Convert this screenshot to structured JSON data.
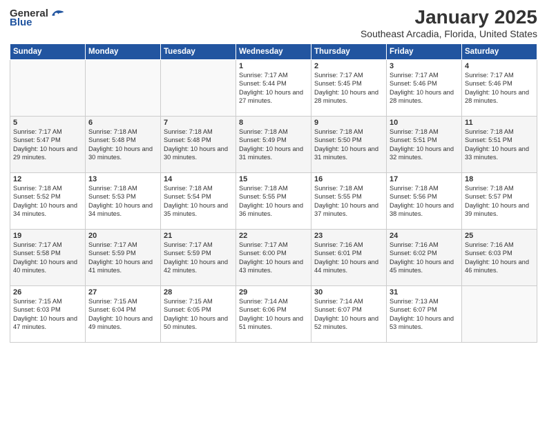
{
  "app": {
    "logo_general": "General",
    "logo_blue": "Blue",
    "title": "January 2025",
    "subtitle": "Southeast Arcadia, Florida, United States"
  },
  "calendar": {
    "headers": [
      "Sunday",
      "Monday",
      "Tuesday",
      "Wednesday",
      "Thursday",
      "Friday",
      "Saturday"
    ],
    "weeks": [
      [
        {
          "day": "",
          "content": ""
        },
        {
          "day": "",
          "content": ""
        },
        {
          "day": "",
          "content": ""
        },
        {
          "day": "1",
          "content": "Sunrise: 7:17 AM\nSunset: 5:44 PM\nDaylight: 10 hours\nand 27 minutes."
        },
        {
          "day": "2",
          "content": "Sunrise: 7:17 AM\nSunset: 5:45 PM\nDaylight: 10 hours\nand 28 minutes."
        },
        {
          "day": "3",
          "content": "Sunrise: 7:17 AM\nSunset: 5:46 PM\nDaylight: 10 hours\nand 28 minutes."
        },
        {
          "day": "4",
          "content": "Sunrise: 7:17 AM\nSunset: 5:46 PM\nDaylight: 10 hours\nand 28 minutes."
        }
      ],
      [
        {
          "day": "5",
          "content": "Sunrise: 7:17 AM\nSunset: 5:47 PM\nDaylight: 10 hours\nand 29 minutes."
        },
        {
          "day": "6",
          "content": "Sunrise: 7:18 AM\nSunset: 5:48 PM\nDaylight: 10 hours\nand 30 minutes."
        },
        {
          "day": "7",
          "content": "Sunrise: 7:18 AM\nSunset: 5:48 PM\nDaylight: 10 hours\nand 30 minutes."
        },
        {
          "day": "8",
          "content": "Sunrise: 7:18 AM\nSunset: 5:49 PM\nDaylight: 10 hours\nand 31 minutes."
        },
        {
          "day": "9",
          "content": "Sunrise: 7:18 AM\nSunset: 5:50 PM\nDaylight: 10 hours\nand 31 minutes."
        },
        {
          "day": "10",
          "content": "Sunrise: 7:18 AM\nSunset: 5:51 PM\nDaylight: 10 hours\nand 32 minutes."
        },
        {
          "day": "11",
          "content": "Sunrise: 7:18 AM\nSunset: 5:51 PM\nDaylight: 10 hours\nand 33 minutes."
        }
      ],
      [
        {
          "day": "12",
          "content": "Sunrise: 7:18 AM\nSunset: 5:52 PM\nDaylight: 10 hours\nand 34 minutes."
        },
        {
          "day": "13",
          "content": "Sunrise: 7:18 AM\nSunset: 5:53 PM\nDaylight: 10 hours\nand 34 minutes."
        },
        {
          "day": "14",
          "content": "Sunrise: 7:18 AM\nSunset: 5:54 PM\nDaylight: 10 hours\nand 35 minutes."
        },
        {
          "day": "15",
          "content": "Sunrise: 7:18 AM\nSunset: 5:55 PM\nDaylight: 10 hours\nand 36 minutes."
        },
        {
          "day": "16",
          "content": "Sunrise: 7:18 AM\nSunset: 5:55 PM\nDaylight: 10 hours\nand 37 minutes."
        },
        {
          "day": "17",
          "content": "Sunrise: 7:18 AM\nSunset: 5:56 PM\nDaylight: 10 hours\nand 38 minutes."
        },
        {
          "day": "18",
          "content": "Sunrise: 7:18 AM\nSunset: 5:57 PM\nDaylight: 10 hours\nand 39 minutes."
        }
      ],
      [
        {
          "day": "19",
          "content": "Sunrise: 7:17 AM\nSunset: 5:58 PM\nDaylight: 10 hours\nand 40 minutes."
        },
        {
          "day": "20",
          "content": "Sunrise: 7:17 AM\nSunset: 5:59 PM\nDaylight: 10 hours\nand 41 minutes."
        },
        {
          "day": "21",
          "content": "Sunrise: 7:17 AM\nSunset: 5:59 PM\nDaylight: 10 hours\nand 42 minutes."
        },
        {
          "day": "22",
          "content": "Sunrise: 7:17 AM\nSunset: 6:00 PM\nDaylight: 10 hours\nand 43 minutes."
        },
        {
          "day": "23",
          "content": "Sunrise: 7:16 AM\nSunset: 6:01 PM\nDaylight: 10 hours\nand 44 minutes."
        },
        {
          "day": "24",
          "content": "Sunrise: 7:16 AM\nSunset: 6:02 PM\nDaylight: 10 hours\nand 45 minutes."
        },
        {
          "day": "25",
          "content": "Sunrise: 7:16 AM\nSunset: 6:03 PM\nDaylight: 10 hours\nand 46 minutes."
        }
      ],
      [
        {
          "day": "26",
          "content": "Sunrise: 7:15 AM\nSunset: 6:03 PM\nDaylight: 10 hours\nand 47 minutes."
        },
        {
          "day": "27",
          "content": "Sunrise: 7:15 AM\nSunset: 6:04 PM\nDaylight: 10 hours\nand 49 minutes."
        },
        {
          "day": "28",
          "content": "Sunrise: 7:15 AM\nSunset: 6:05 PM\nDaylight: 10 hours\nand 50 minutes."
        },
        {
          "day": "29",
          "content": "Sunrise: 7:14 AM\nSunset: 6:06 PM\nDaylight: 10 hours\nand 51 minutes."
        },
        {
          "day": "30",
          "content": "Sunrise: 7:14 AM\nSunset: 6:07 PM\nDaylight: 10 hours\nand 52 minutes."
        },
        {
          "day": "31",
          "content": "Sunrise: 7:13 AM\nSunset: 6:07 PM\nDaylight: 10 hours\nand 53 minutes."
        },
        {
          "day": "",
          "content": ""
        }
      ]
    ]
  }
}
